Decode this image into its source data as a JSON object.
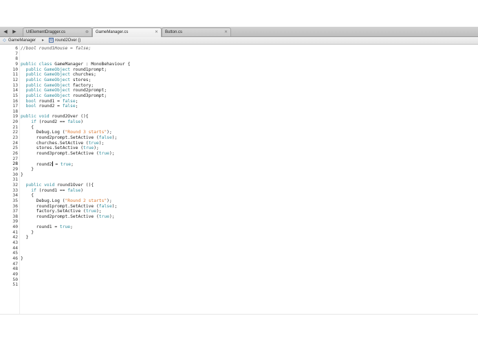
{
  "tabs": {
    "back_arrow": "◀",
    "forward_arrow": "▶",
    "items": [
      {
        "label": "UIElementDragger.cs",
        "close": "⊗"
      },
      {
        "label": "GameManager.cs",
        "close": "✕"
      },
      {
        "label": "Button.cs",
        "close": "✕"
      }
    ]
  },
  "jumpbar": {
    "class_icon": "◇",
    "class_name": "GameManager",
    "separator": "▸",
    "method_icon": "M",
    "method_name": "round2Over ()"
  },
  "code_lines": [
    {
      "n": "6",
      "indent": 0,
      "parts": [
        [
          "cm",
          "//bool round1House = false;"
        ]
      ]
    },
    {
      "n": "7",
      "indent": 0,
      "parts": []
    },
    {
      "n": "8",
      "indent": 0,
      "parts": []
    },
    {
      "n": "9",
      "indent": 0,
      "parts": [
        [
          "kw",
          "public class "
        ],
        [
          "p",
          "GameManager : MonoBehaviour {"
        ]
      ]
    },
    {
      "n": "10",
      "indent": 2,
      "parts": [
        [
          "kw",
          "public "
        ],
        [
          "kw",
          "GameObject "
        ],
        [
          "p",
          "round1prompt;"
        ]
      ]
    },
    {
      "n": "11",
      "indent": 2,
      "parts": [
        [
          "kw",
          "public "
        ],
        [
          "kw",
          "GameObject "
        ],
        [
          "p",
          "churches;"
        ]
      ]
    },
    {
      "n": "12",
      "indent": 2,
      "parts": [
        [
          "kw",
          "public "
        ],
        [
          "kw",
          "GameObject "
        ],
        [
          "p",
          "stores;"
        ]
      ]
    },
    {
      "n": "13",
      "indent": 2,
      "parts": [
        [
          "kw",
          "public "
        ],
        [
          "kw",
          "GameObject "
        ],
        [
          "p",
          "factory;"
        ]
      ]
    },
    {
      "n": "14",
      "indent": 2,
      "parts": [
        [
          "kw",
          "public "
        ],
        [
          "kw",
          "GameObject "
        ],
        [
          "p",
          "round2prompt;"
        ]
      ]
    },
    {
      "n": "15",
      "indent": 2,
      "parts": [
        [
          "kw",
          "public "
        ],
        [
          "kw",
          "GameObject "
        ],
        [
          "p",
          "round3prompt;"
        ]
      ]
    },
    {
      "n": "16",
      "indent": 2,
      "parts": [
        [
          "kw",
          "bool "
        ],
        [
          "p",
          "round1 = "
        ],
        [
          "kw",
          "false"
        ],
        [
          "p",
          ";"
        ]
      ]
    },
    {
      "n": "17",
      "indent": 2,
      "parts": [
        [
          "kw",
          "bool "
        ],
        [
          "p",
          "round2 = "
        ],
        [
          "kw",
          "false"
        ],
        [
          "p",
          ";"
        ]
      ]
    },
    {
      "n": "18",
      "indent": 0,
      "parts": []
    },
    {
      "n": "19",
      "indent": 0,
      "parts": [
        [
          "kw",
          "public void "
        ],
        [
          "p",
          "round2Over (){"
        ]
      ]
    },
    {
      "n": "20",
      "indent": 4,
      "parts": [
        [
          "kw",
          "if "
        ],
        [
          "p",
          "(round2 == "
        ],
        [
          "kw",
          "false"
        ],
        [
          "p",
          ")"
        ]
      ]
    },
    {
      "n": "21",
      "indent": 4,
      "parts": [
        [
          "p",
          "{"
        ]
      ]
    },
    {
      "n": "22",
      "indent": 6,
      "parts": [
        [
          "p",
          "Debug.Log ("
        ],
        [
          "str",
          "\"Round 3 starts\""
        ],
        [
          "p",
          ");"
        ]
      ]
    },
    {
      "n": "23",
      "indent": 6,
      "parts": [
        [
          "p",
          "round2prompt.SetActive ("
        ],
        [
          "kw",
          "false"
        ],
        [
          "p",
          ");"
        ]
      ]
    },
    {
      "n": "24",
      "indent": 6,
      "parts": [
        [
          "p",
          "churches.SetActive ("
        ],
        [
          "kw",
          "true"
        ],
        [
          "p",
          ");"
        ]
      ]
    },
    {
      "n": "25",
      "indent": 6,
      "parts": [
        [
          "p",
          "stores.SetActive ("
        ],
        [
          "kw",
          "true"
        ],
        [
          "p",
          ");"
        ]
      ]
    },
    {
      "n": "26",
      "indent": 6,
      "parts": [
        [
          "p",
          "round3prompt.SetActive ("
        ],
        [
          "kw",
          "true"
        ],
        [
          "p",
          ");"
        ]
      ]
    },
    {
      "n": "27",
      "indent": 0,
      "parts": []
    },
    {
      "n": "28",
      "indent": 6,
      "current": true,
      "parts": [
        [
          "p",
          "round2"
        ],
        [
          "caret",
          ""
        ],
        [
          "p",
          " = "
        ],
        [
          "kw",
          "true"
        ],
        [
          "p",
          ";"
        ]
      ]
    },
    {
      "n": "29",
      "indent": 4,
      "parts": [
        [
          "p",
          "}"
        ]
      ]
    },
    {
      "n": "30",
      "indent": 0,
      "parts": [
        [
          "p",
          "}"
        ]
      ]
    },
    {
      "n": "31",
      "indent": 0,
      "parts": []
    },
    {
      "n": "32",
      "indent": 2,
      "parts": [
        [
          "kw",
          "public void "
        ],
        [
          "p",
          "round1Over (){"
        ]
      ]
    },
    {
      "n": "33",
      "indent": 4,
      "parts": [
        [
          "kw",
          "if "
        ],
        [
          "p",
          "(round1 == "
        ],
        [
          "kw",
          "false"
        ],
        [
          "p",
          ")"
        ]
      ]
    },
    {
      "n": "34",
      "indent": 4,
      "parts": [
        [
          "p",
          "{"
        ]
      ]
    },
    {
      "n": "35",
      "indent": 6,
      "parts": [
        [
          "p",
          "Debug.Log ("
        ],
        [
          "str",
          "\"Round 2 starts\""
        ],
        [
          "p",
          ");"
        ]
      ]
    },
    {
      "n": "36",
      "indent": 6,
      "parts": [
        [
          "p",
          "round1prompt.SetActive ("
        ],
        [
          "kw",
          "false"
        ],
        [
          "p",
          ");"
        ]
      ]
    },
    {
      "n": "37",
      "indent": 6,
      "parts": [
        [
          "p",
          "factory.SetActive ("
        ],
        [
          "kw",
          "true"
        ],
        [
          "p",
          ");"
        ]
      ]
    },
    {
      "n": "38",
      "indent": 6,
      "parts": [
        [
          "p",
          "round2prompt.SetActive ("
        ],
        [
          "kw",
          "true"
        ],
        [
          "p",
          ");"
        ]
      ]
    },
    {
      "n": "39",
      "indent": 0,
      "parts": []
    },
    {
      "n": "40",
      "indent": 6,
      "parts": [
        [
          "p",
          "round1 = "
        ],
        [
          "kw",
          "true"
        ],
        [
          "p",
          ";"
        ]
      ]
    },
    {
      "n": "41",
      "indent": 4,
      "parts": [
        [
          "p",
          "}"
        ]
      ]
    },
    {
      "n": "42",
      "indent": 2,
      "parts": [
        [
          "p",
          "}"
        ]
      ]
    },
    {
      "n": "43",
      "indent": 0,
      "parts": []
    },
    {
      "n": "44",
      "indent": 0,
      "parts": []
    },
    {
      "n": "45",
      "indent": 0,
      "parts": []
    },
    {
      "n": "46",
      "indent": 0,
      "parts": [
        [
          "p",
          "}"
        ]
      ]
    },
    {
      "n": "47",
      "indent": 0,
      "parts": []
    },
    {
      "n": "48",
      "indent": 0,
      "parts": []
    },
    {
      "n": "49",
      "indent": 0,
      "parts": []
    },
    {
      "n": "50",
      "indent": 0,
      "parts": []
    },
    {
      "n": "51",
      "indent": 0,
      "parts": []
    }
  ],
  "colors": {
    "keyword": "#2f8a9a",
    "string": "#d8762e",
    "comment": "#555555",
    "text": "#1a1a1a"
  }
}
